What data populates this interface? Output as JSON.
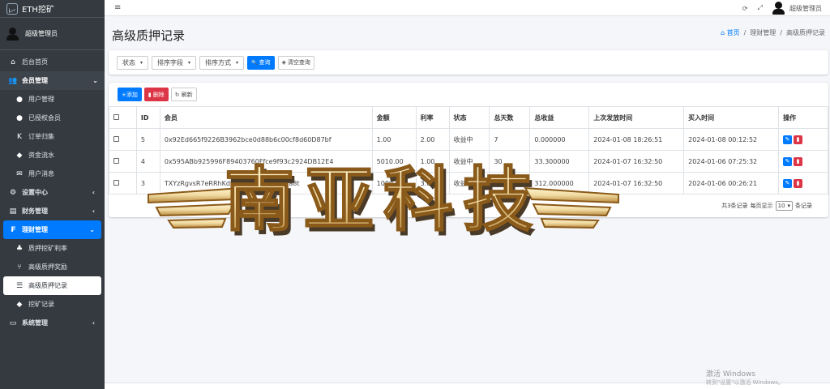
{
  "app": {
    "brand": "ETH挖矿",
    "admin_name": "超级管理员"
  },
  "sidebar": {
    "items": [
      {
        "label": "后台首页",
        "icon": "home-icon",
        "glyph": "⌂"
      },
      {
        "label": "会员管理",
        "icon": "users-icon",
        "glyph": "👥",
        "arrow": "⌄"
      },
      {
        "label": "用户管理",
        "icon": "user-icon",
        "glyph": "●"
      },
      {
        "label": "已授权会员",
        "icon": "user-check-icon",
        "glyph": "●"
      },
      {
        "label": "订单归集",
        "icon": "k-icon",
        "glyph": "K"
      },
      {
        "label": "资金流水",
        "icon": "droplet-icon",
        "glyph": "◆"
      },
      {
        "label": "用户消息",
        "icon": "envelope-icon",
        "glyph": "✉"
      },
      {
        "label": "设置中心",
        "icon": "cogs-icon",
        "glyph": "⚙",
        "arrow": "‹"
      },
      {
        "label": "财务管理",
        "icon": "wallet-icon",
        "glyph": "▤",
        "arrow": "‹"
      },
      {
        "label": "理财管理",
        "icon": "finance-icon",
        "glyph": "₣",
        "arrow": "⌄"
      },
      {
        "label": "质押挖矿利率",
        "icon": "mining-icon",
        "glyph": "♣"
      },
      {
        "label": "高级质押奖励",
        "icon": "branch-icon",
        "glyph": "⑂"
      },
      {
        "label": "高级质押记录",
        "icon": "list-icon",
        "glyph": "☰"
      },
      {
        "label": "挖矿记录",
        "icon": "droplet-icon",
        "glyph": "◆"
      },
      {
        "label": "系统管理",
        "icon": "desktop-icon",
        "glyph": "▭",
        "arrow": "‹"
      }
    ]
  },
  "topbar": {
    "menu_icon": "≡",
    "refresh_icon": "⟳",
    "fullscreen_icon": "⤢",
    "user": "超级管理员"
  },
  "page": {
    "title": "高级质押记录",
    "breadcrumb": [
      "首页",
      "理财管理",
      "高级质押记录"
    ],
    "breadcrumb_sep": "/",
    "home_glyph": "⌂"
  },
  "filters": {
    "status": "状态",
    "sort_field": "排序字段",
    "sort_order": "排序方式",
    "search_label": "查询",
    "search_icon_glyph": "🔍",
    "clear_label": "清空查询",
    "clear_icon_glyph": "◈",
    "caret": "▾"
  },
  "toolbar": {
    "add_label": "+添加",
    "delete_label": "删除",
    "delete_icon_glyph": "▮",
    "refresh_label": "刷新",
    "refresh_glyph": "↻"
  },
  "table": {
    "headers": [
      "ID",
      "会员",
      "金额",
      "利率",
      "状态",
      "总天数",
      "总收益",
      "上次发放时间",
      "买入时间",
      "操作"
    ],
    "rows": [
      [
        "5",
        "0x92Ed665f9226B3962bce0d88b6c00cf8d60D87bf",
        "1.00",
        "2.00",
        "收益中",
        "7",
        "0.000000",
        "2024-01-08 18:26:51",
        "2024-01-08 00:12:52"
      ],
      [
        "4",
        "0x595ABb925996F89403760Ffce9f93c2924DB12E4",
        "5010.00",
        "1.00",
        "收益中",
        "30",
        "33.300000",
        "2024-01-07 16:32:50",
        "2024-01-06 07:25:32"
      ],
      [
        "3",
        "TXYzRgvsR7eRRhKdvMixEQqVnoJ7pvva8t",
        "1000.00",
        "3.00",
        "收益中",
        "10",
        "312.000000",
        "2024-01-07 16:32:50",
        "2024-01-06 00:26:21"
      ]
    ],
    "edit_glyph": "✎",
    "delete_glyph": "▮"
  },
  "pager": {
    "total": "共3条记录",
    "per_page_label": "每页显示",
    "per_page_value": "10",
    "caret": "▾",
    "suffix": "条记录"
  },
  "watermark": {
    "text": "南亚科技",
    "fill": "#f0d9a0",
    "outline": "#8a5a1a"
  },
  "windows": {
    "activate": "激活 Windows",
    "activate_sub": "转到\"设置\"以激活 Windows。"
  },
  "colors": {
    "sidebar_bg": "#343a40",
    "primary": "#007bff",
    "danger": "#dc3545"
  }
}
